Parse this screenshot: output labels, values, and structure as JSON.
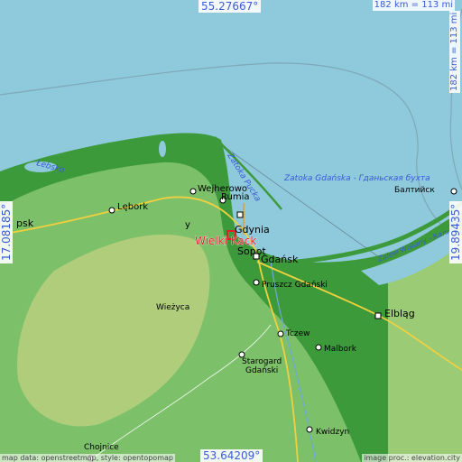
{
  "coords": {
    "top": "55.27667°",
    "bottom": "53.64209°",
    "left": "17.08185°",
    "right": "19.89435°"
  },
  "scale": {
    "top": "182 km = 113 mi",
    "right": "182 km = 113 mi"
  },
  "attribution": {
    "left": "map data: openstreetmap, style: opentopomap",
    "right": "image proc.: elevation.city"
  },
  "place": {
    "name": "Wielki Kack",
    "color": "#e0202a"
  },
  "labels": {
    "gdansk": "Gdańsk",
    "gdynia": "Gdynia",
    "sopot": "Sopot",
    "rumia": "Rumia",
    "wejherowo": "Wejherowo",
    "lebork": "Lębork",
    "lebsko": "Łebsko",
    "slupsk": "psk",
    "elblag": "Elbląg",
    "baltijsk": "Балтийск",
    "pruszcz": "Pruszcz Gdański",
    "tczew": "Tczew",
    "malbork": "Malbork",
    "starogard1": "Starogard",
    "starogard2": "Gdański",
    "kwidzyn": "Kwidzyn",
    "chojnice": "Chojnice",
    "wiezyca": "Wieżyca",
    "zatoka_pucka": "Zatoka Pucka",
    "zatoka_gdanska": "Zatoka Gdańska - Гданьская бухта",
    "zalew": "Zalew Wiślany - Калин",
    "kaszuby": "y"
  },
  "colors": {
    "sea": "#8fc9dc",
    "land_low": "#3d9a3a",
    "land_mid": "#7cc06a",
    "land_high": "#b9cf7c",
    "road": "#f0d040",
    "label": "#3a5bd6"
  }
}
